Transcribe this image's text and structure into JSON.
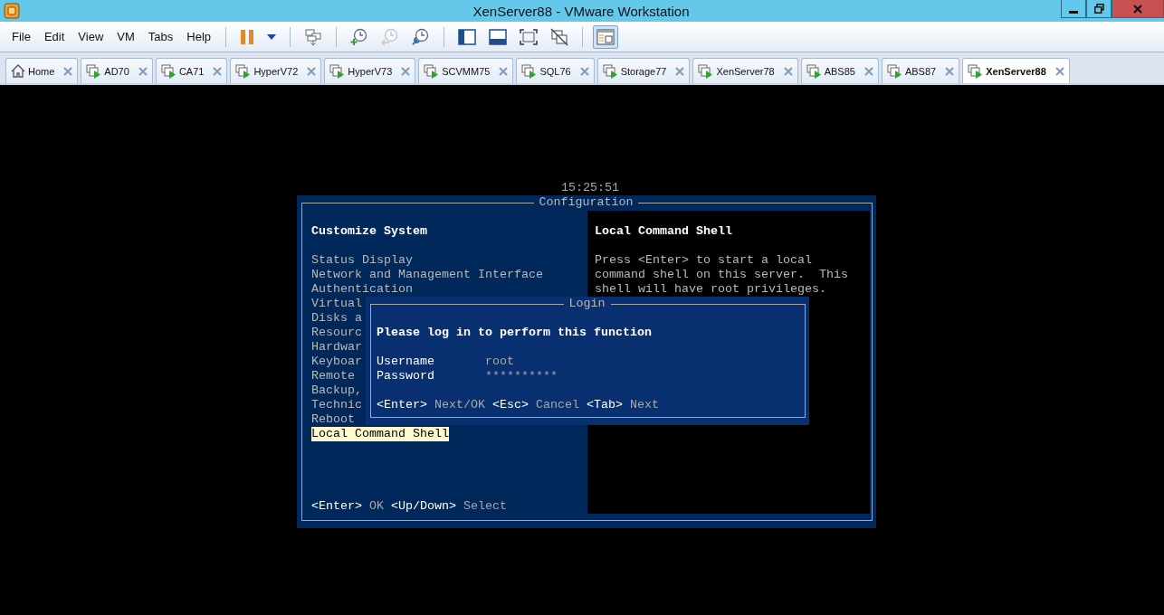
{
  "window": {
    "title": "XenServer88 - VMware Workstation"
  },
  "menu": [
    {
      "label": "File"
    },
    {
      "label": "Edit"
    },
    {
      "label": "View"
    },
    {
      "label": "VM"
    },
    {
      "label": "Tabs"
    },
    {
      "label": "Help"
    }
  ],
  "toolbar": [
    [
      {
        "kind": "pause",
        "disabled": false,
        "selected": false
      },
      {
        "kind": "dropdown",
        "disabled": false,
        "selected": false
      }
    ],
    [
      {
        "kind": "send-keys",
        "disabled": false,
        "selected": false
      }
    ],
    [
      {
        "kind": "snapshot-take",
        "disabled": false,
        "selected": false
      },
      {
        "kind": "snapshot-revert",
        "disabled": true,
        "selected": false
      },
      {
        "kind": "snapshot-manager",
        "disabled": false,
        "selected": false
      }
    ],
    [
      {
        "kind": "view-sidebar",
        "disabled": false,
        "selected": false
      },
      {
        "kind": "view-thumbnail",
        "disabled": false,
        "selected": false
      },
      {
        "kind": "fullscreen",
        "disabled": false,
        "selected": false
      },
      {
        "kind": "unity",
        "disabled": false,
        "selected": false
      }
    ],
    [
      {
        "kind": "console-view",
        "disabled": false,
        "selected": true
      }
    ]
  ],
  "tabs": [
    {
      "label": "Home",
      "kind": "home",
      "selected": false
    },
    {
      "label": "AD70",
      "kind": "vm",
      "selected": false
    },
    {
      "label": "CA71",
      "kind": "vm",
      "selected": false
    },
    {
      "label": "HyperV72",
      "kind": "vm",
      "selected": false
    },
    {
      "label": "HyperV73",
      "kind": "vm",
      "selected": false
    },
    {
      "label": "SCVMM75",
      "kind": "vm",
      "selected": false
    },
    {
      "label": "SQL76",
      "kind": "vm",
      "selected": false
    },
    {
      "label": "Storage77",
      "kind": "vm",
      "selected": false
    },
    {
      "label": "XenServer78",
      "kind": "vm",
      "selected": false
    },
    {
      "label": "ABS85",
      "kind": "vm",
      "selected": false
    },
    {
      "label": "ABS87",
      "kind": "vm",
      "selected": false
    },
    {
      "label": "XenServer88",
      "kind": "vm",
      "selected": true
    }
  ],
  "console": {
    "clock": "15:25:51",
    "configuration": {
      "title": "Configuration",
      "heading": "Customize System",
      "items": [
        {
          "label": "Status Display",
          "selected": false
        },
        {
          "label": "Network and Management Interface",
          "selected": false
        },
        {
          "label": "Authentication",
          "selected": false
        },
        {
          "label": "Virtual",
          "selected": false
        },
        {
          "label": "Disks a",
          "selected": false
        },
        {
          "label": "Resourc",
          "selected": false
        },
        {
          "label": "Hardwar",
          "selected": false
        },
        {
          "label": "Keyboar",
          "selected": false
        },
        {
          "label": "Remote",
          "selected": false
        },
        {
          "label": "Backup,",
          "selected": false
        },
        {
          "label": "Technic",
          "selected": false
        },
        {
          "label": "Reboot",
          "selected": false
        },
        {
          "label": "Local Command Shell",
          "selected": true
        }
      ],
      "hints": [
        {
          "key": "<Enter>",
          "action": "OK"
        },
        {
          "key": "<Up/Down>",
          "action": "Select"
        }
      ],
      "detail": {
        "title": "Local Command Shell",
        "text": "Press <Enter> to start a local command shell on this server.  This shell will have root privileges."
      }
    },
    "login": {
      "title": "Login",
      "prompt": "Please log in to perform this function",
      "fields": [
        {
          "label": "Username",
          "value": "root"
        },
        {
          "label": "Password",
          "value": "**********"
        }
      ],
      "hints": [
        {
          "key": "<Enter>",
          "action": "Next/OK"
        },
        {
          "key": "<Esc>",
          "action": "Cancel"
        },
        {
          "key": "<Tab>",
          "action": "Next"
        }
      ]
    }
  }
}
